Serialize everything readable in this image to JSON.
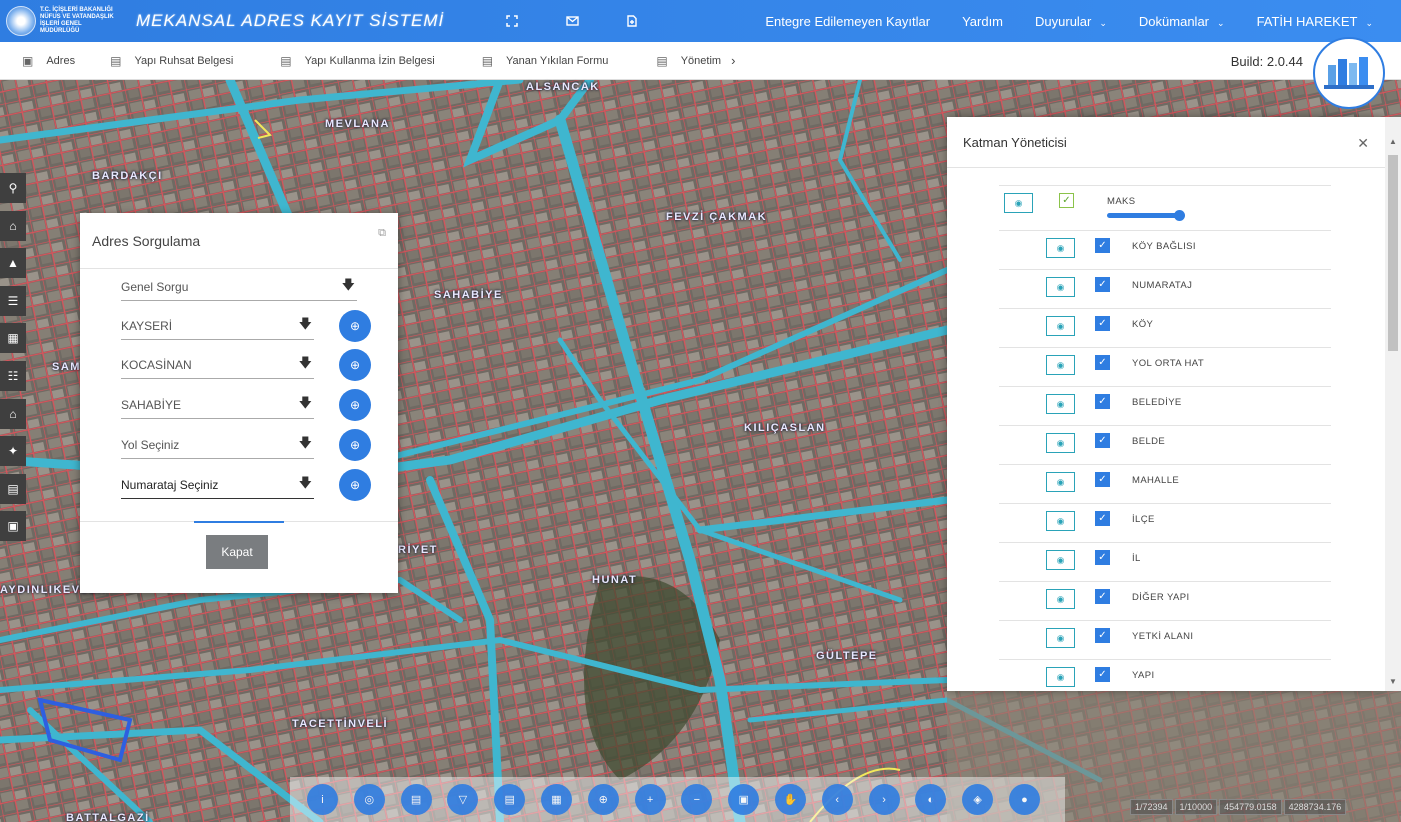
{
  "header": {
    "logo_text": "T.C. İÇİŞLERİ BAKANLIĞI NÜFUS VE VATANDAŞLIK İŞLERİ GENEL MÜDÜRLÜĞÜ",
    "app_title": "MEKANSAL ADRES KAYIT SİSTEMİ",
    "icons": [
      "fullscreen-icon",
      "mail-icon",
      "document-icon"
    ],
    "nav": [
      {
        "label": "Entegre Edilemeyen Kayıtlar",
        "dropdown": false
      },
      {
        "label": "Yardım",
        "dropdown": false
      },
      {
        "label": "Duyurular",
        "dropdown": true
      },
      {
        "label": "Dokümanlar",
        "dropdown": true
      },
      {
        "label": "FATİH HAREKET",
        "dropdown": true
      }
    ]
  },
  "menu": {
    "items": [
      {
        "label": "Adres",
        "icon": "map-icon"
      },
      {
        "label": "Yapı Ruhsat Belgesi",
        "icon": "file-word-icon"
      },
      {
        "label": "Yapı Kullanma İzin Belgesi",
        "icon": "file-word-icon"
      },
      {
        "label": "Yanan Yıkılan Formu",
        "icon": "file-word-icon"
      },
      {
        "label": "Yönetim",
        "icon": "file-word-icon"
      }
    ],
    "more_arrow": "›",
    "build": "Build: 2.0.44"
  },
  "left_tools": [
    "search-icon",
    "home-icon",
    "road-icon",
    "list-icon",
    "building-icon",
    "sitemap-icon",
    "institution-icon",
    "magic-icon",
    "file-icon",
    "archive-icon"
  ],
  "map_labels": {
    "alsancak": "ALSANCAK",
    "mevlana": "MEVLANA",
    "bardakci": "BARDAKÇI",
    "fevzi": "FEVZİ ÇAKMAK",
    "sahabiye": "SAHABİYE",
    "kilicaslan": "KILIÇASLAN",
    "hunat": "HUNAT",
    "gultepe": "GÜLTEPE",
    "tacettin": "TACETTİNVELİ",
    "battalgazi": "BATTALGAZİ",
    "aydinlikevler": "AYDINLIKEVLER",
    "hurriyet": "RİYET",
    "sam": "SAM"
  },
  "address_panel": {
    "title": "Adres Sorgulama",
    "general_query": "Genel Sorgu",
    "fields": [
      {
        "value": "KAYSERİ"
      },
      {
        "value": "KOCASİNAN"
      },
      {
        "value": "SAHABİYE"
      },
      {
        "value": "Yol Seçiniz"
      },
      {
        "value": "Numarataj Seçiniz"
      }
    ],
    "close_label": "Kapat"
  },
  "layer_panel": {
    "title": "Katman Yöneticisi",
    "root": {
      "name": "MAKS",
      "opacity": 1.0
    },
    "layers": [
      {
        "name": "KÖY BAĞLISI",
        "checked": true
      },
      {
        "name": "NUMARATAJ",
        "checked": true
      },
      {
        "name": "KÖY",
        "checked": true
      },
      {
        "name": "YOL ORTA HAT",
        "checked": true
      },
      {
        "name": "BELEDİYE",
        "checked": true
      },
      {
        "name": "BELDE",
        "checked": true
      },
      {
        "name": "MAHALLE",
        "checked": true
      },
      {
        "name": "İLÇE",
        "checked": true
      },
      {
        "name": "İL",
        "checked": true
      },
      {
        "name": "DİĞER YAPI",
        "checked": true
      },
      {
        "name": "YETKİ ALANI",
        "checked": true
      },
      {
        "name": "YAPI",
        "checked": true
      }
    ]
  },
  "bottom_tools": [
    "info-icon",
    "layers-icon",
    "print-icon",
    "filter-icon",
    "print-icon-2",
    "building-tool-icon",
    "crosshair-icon",
    "zoom-in-icon",
    "zoom-out-icon",
    "extent-icon",
    "pan-icon",
    "previous-icon",
    "next-icon",
    "measure-icon",
    "compass-icon",
    "pin-icon"
  ],
  "coordinates": [
    "1/72394",
    "1/10000",
    "454779.0158",
    "4288734.176"
  ],
  "colors": {
    "primary": "#2f7de1",
    "road": "#3fb6cf",
    "parcel": "#e05a5a"
  }
}
